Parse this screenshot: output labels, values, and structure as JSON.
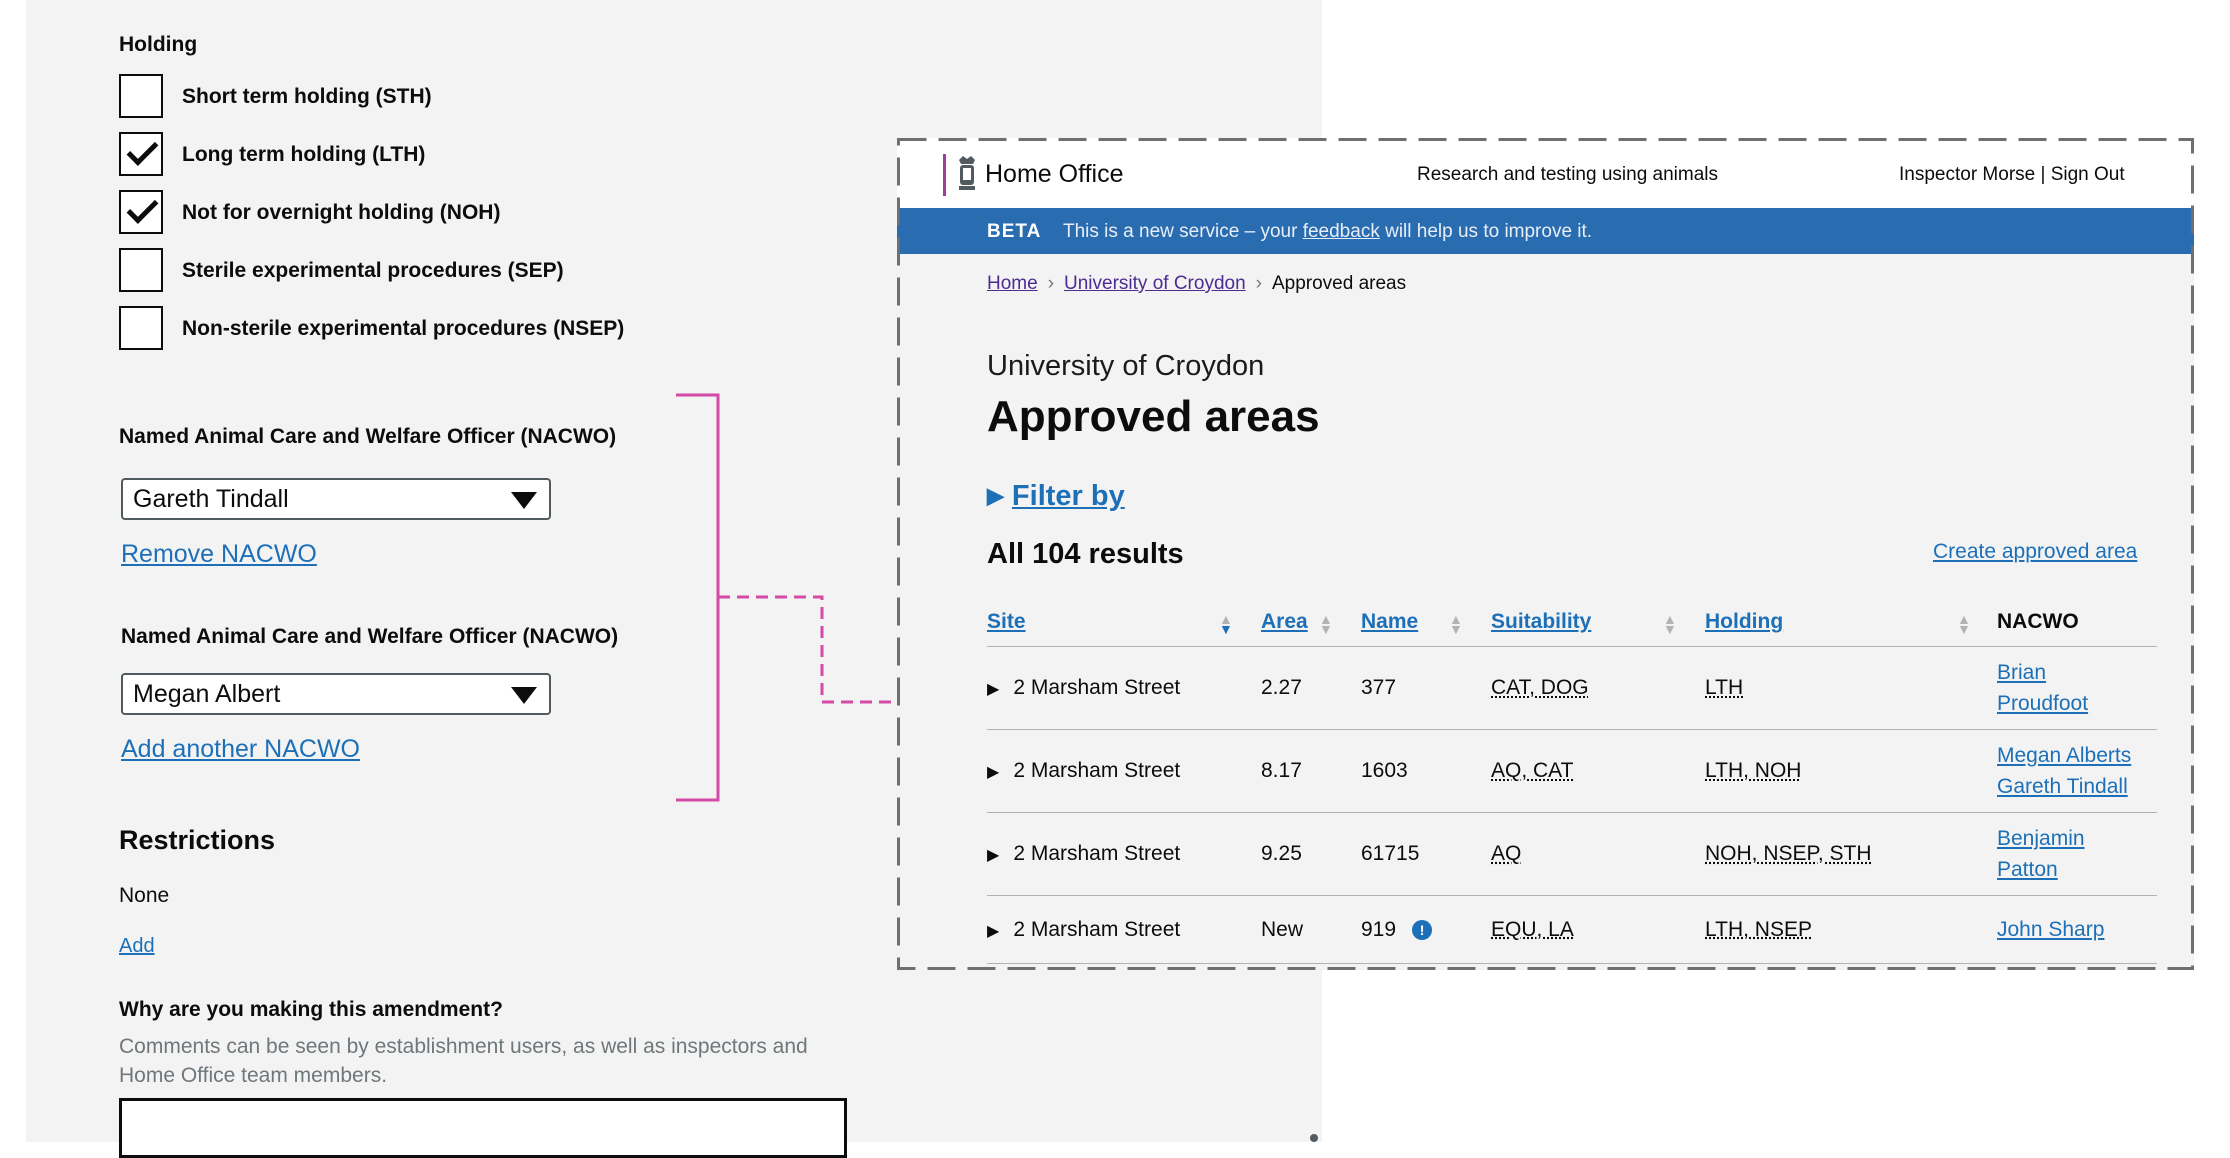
{
  "left_form": {
    "holding_heading": "Holding",
    "holding_options": [
      {
        "label": "Short term holding (STH)",
        "checked": false
      },
      {
        "label": "Long term holding (LTH)",
        "checked": true
      },
      {
        "label": "Not for overnight holding (NOH)",
        "checked": true
      },
      {
        "label": "Sterile experimental procedures (SEP)",
        "checked": false
      },
      {
        "label": "Non-sterile experimental procedures (NSEP)",
        "checked": false
      }
    ],
    "nacwo_blocks": [
      {
        "heading": "Named Animal Care and Welfare Officer (NACWO)",
        "selected": "Gareth Tindall",
        "action_link": "Remove NACWO"
      },
      {
        "heading": "Named Animal Care and Welfare Officer (NACWO)",
        "selected": "Megan Albert",
        "action_link": "Add another NACWO"
      }
    ],
    "restrictions": {
      "heading": "Restrictions",
      "value": "None",
      "add_link": "Add"
    },
    "amendment": {
      "question": "Why are you making this amendment?",
      "hint": "Comments can be seen by establishment users, as well as inspectors and Home Office team members."
    }
  },
  "preview": {
    "header": {
      "brand": "Home Office",
      "service": "Research and testing using animals",
      "user": "Inspector Morse  |  Sign Out"
    },
    "beta_banner": {
      "tag": "BETA",
      "text_before": "This is a new service – your ",
      "link": "feedback",
      "text_after": " will help us to improve it."
    },
    "breadcrumbs": [
      "Home",
      "University of Croydon",
      "Approved areas"
    ],
    "caption": "University of Croydon",
    "title": "Approved areas",
    "filter_label": "Filter by",
    "results_label": "All 104 results",
    "create_link": "Create approved area",
    "table": {
      "columns": [
        "Site",
        "Area",
        "Name",
        "Suitability",
        "Holding",
        "NACWO"
      ],
      "rows": [
        {
          "site": "2 Marsham Street",
          "area": "2.27",
          "name": "377",
          "suitability": "CAT, DOG",
          "holding": "LTH",
          "nacwo": [
            "Brian",
            "Proudfoot"
          ],
          "flag": false
        },
        {
          "site": "2 Marsham Street",
          "area": "8.17",
          "name": "1603",
          "suitability": "AQ, CAT",
          "holding": "LTH, NOH",
          "nacwo": [
            "Megan Alberts",
            "Gareth Tindall"
          ],
          "flag": false
        },
        {
          "site": "2 Marsham Street",
          "area": "9.25",
          "name": "61715",
          "suitability": "AQ",
          "holding": "NOH, NSEP, STH",
          "nacwo": [
            "Benjamin",
            "Patton"
          ],
          "flag": false
        },
        {
          "site": "2 Marsham Street",
          "area": "New",
          "name": "919",
          "suitability": "EQU, LA",
          "holding": "LTH, NSEP",
          "nacwo": [
            "John Sharp"
          ],
          "flag": true
        }
      ]
    }
  },
  "colors": {
    "link": "#1d70b8",
    "beta_banner": "#2a6cb0",
    "annotation_pink": "#d64aa7",
    "header_bar": "#a03d9f"
  }
}
